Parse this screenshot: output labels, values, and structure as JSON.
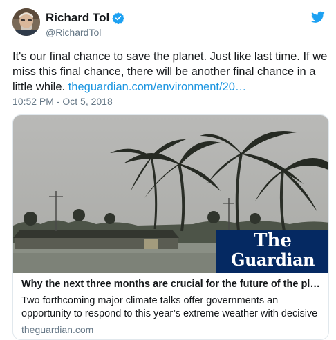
{
  "author": {
    "name": "Richard Tol",
    "handle": "@RichardTol",
    "verified": true
  },
  "tweet": {
    "text": "It's our final chance to save the planet. Just like last time. If we miss this final chance, there will be another final chance in a little while. ",
    "link_text": "theguardian.com/environment/20…",
    "timestamp": "10:52 PM - Oct 5, 2018"
  },
  "card": {
    "logo_line1": "The",
    "logo_line2": "Guardian",
    "title": "Why the next three months are crucial for the future of the pla…",
    "description": "Two forthcoming major climate talks offer governments an opportunity to respond to this year’s extreme weather with decisive",
    "domain": "theguardian.com"
  },
  "icons": {
    "verified": "verified-badge-icon",
    "brand": "twitter-bird-icon"
  },
  "colors": {
    "link": "#1b95e0",
    "verified": "#1da1f2",
    "secondary_text": "#657786",
    "guardian_blue": "#052962"
  }
}
